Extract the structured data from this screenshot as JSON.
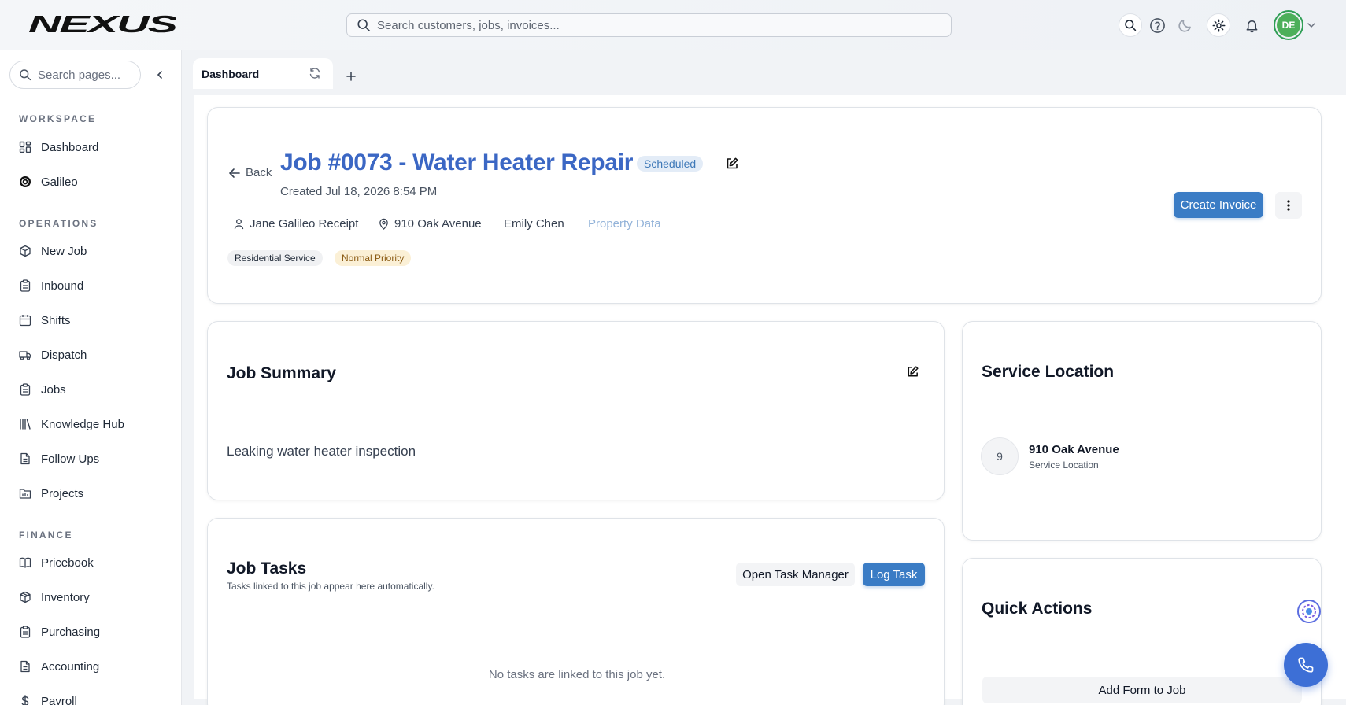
{
  "topbar": {
    "logo_text": "NEXUS",
    "search_placeholder": "Search customers, jobs, invoices...",
    "avatar_initials": "DE"
  },
  "sidebar": {
    "search_placeholder": "Search pages...",
    "sections": [
      {
        "title": "WORKSPACE",
        "items": [
          {
            "label": "Dashboard",
            "icon": "dashboard-icon"
          },
          {
            "label": "Galileo",
            "icon": "galileo-icon"
          }
        ]
      },
      {
        "title": "OPERATIONS",
        "items": [
          {
            "label": "New Job",
            "icon": "box-icon"
          },
          {
            "label": "Inbound",
            "icon": "clipboard-icon"
          },
          {
            "label": "Shifts",
            "icon": "calendar-icon"
          },
          {
            "label": "Dispatch",
            "icon": "truck-icon"
          },
          {
            "label": "Jobs",
            "icon": "clipboard-icon"
          },
          {
            "label": "Knowledge Hub",
            "icon": "library-icon"
          },
          {
            "label": "Follow Ups",
            "icon": "document-icon"
          },
          {
            "label": "Projects",
            "icon": "folder-icon"
          }
        ]
      },
      {
        "title": "FINANCE",
        "items": [
          {
            "label": "Pricebook",
            "icon": "book-icon"
          },
          {
            "label": "Inventory",
            "icon": "package-icon"
          },
          {
            "label": "Purchasing",
            "icon": "clipboard-icon"
          },
          {
            "label": "Accounting",
            "icon": "document-icon"
          },
          {
            "label": "Payroll",
            "icon": "dollar-icon"
          }
        ]
      }
    ]
  },
  "tabs": [
    {
      "label": "Dashboard"
    }
  ],
  "job": {
    "back_label": "Back",
    "title": "Job #0073 - Water Heater Repair",
    "status": "Scheduled",
    "created": "Created Jul 18, 2026 8:54 PM",
    "customer": "Jane Galileo Receipt",
    "address": "910 Oak Avenue",
    "technician": "Emily Chen",
    "property_link": "Property Data",
    "tags": [
      "Residential Service",
      "Normal Priority"
    ],
    "create_invoice_label": "Create Invoice"
  },
  "summary": {
    "title": "Job Summary",
    "text": "Leaking water heater inspection"
  },
  "tasks": {
    "title": "Job Tasks",
    "subtitle": "Tasks linked to this job appear here automatically.",
    "open_manager_label": "Open Task Manager",
    "log_task_label": "Log Task",
    "empty_text": "No tasks are linked to this job yet."
  },
  "location": {
    "title": "Service Location",
    "marker": "9",
    "address": "910 Oak Avenue",
    "label": "Service Location"
  },
  "quick_actions": {
    "title": "Quick Actions",
    "add_form_label": "Add Form to Job"
  },
  "colors": {
    "accent": "#3a7cc5",
    "title": "#3b67c4",
    "status_bg": "#e3ecf7",
    "priority_bg": "#fbf0d6"
  }
}
